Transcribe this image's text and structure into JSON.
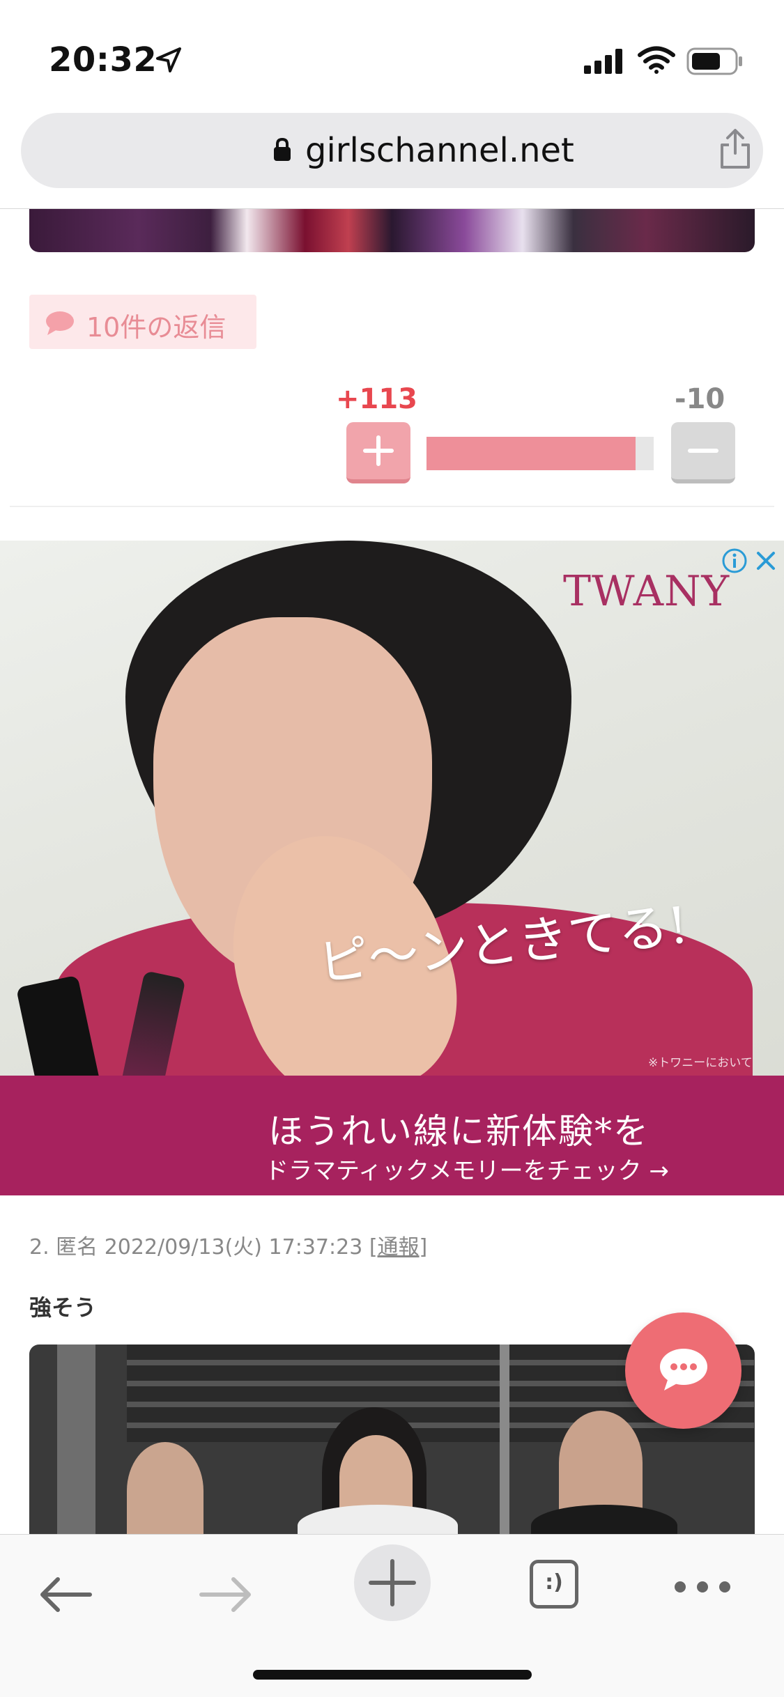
{
  "status_bar": {
    "time": "20:32",
    "icons": [
      "location-arrow-icon",
      "cellular-signal-icon",
      "wifi-icon",
      "battery-icon"
    ]
  },
  "url_bar": {
    "url": "girlschannel.net",
    "icons": [
      "lock-icon",
      "share-icon"
    ]
  },
  "comment_1": {
    "replies_label": "10件の返信",
    "vote_plus": "+113",
    "vote_minus": "-10",
    "vote_ratio": 0.919
  },
  "ad": {
    "brand": "TWANY",
    "catchphrase": "ピ〜ンときてる!",
    "note": "※トワニーにおいて",
    "headline": "ほうれい線に新体験*を",
    "subline": "ドラマティックメモリーをチェック →",
    "icons": [
      "ad-info-icon",
      "ad-close-icon"
    ]
  },
  "comment_2": {
    "meta_prefix": "2. 匿名 2022/09/13(火) 17:37:23 [",
    "report_label": "通報",
    "meta_suffix": "]",
    "body": "強そう"
  },
  "colors": {
    "accent_pink": "#ee6d74",
    "plus_red": "#e8474f",
    "ad_magenta": "#a7225e"
  },
  "toolbar": {
    "tabs_glyph": ":)",
    "icons": [
      "back-arrow-icon",
      "forward-arrow-icon",
      "new-tab-plus-icon",
      "tabs-icon",
      "more-dots-icon"
    ]
  }
}
